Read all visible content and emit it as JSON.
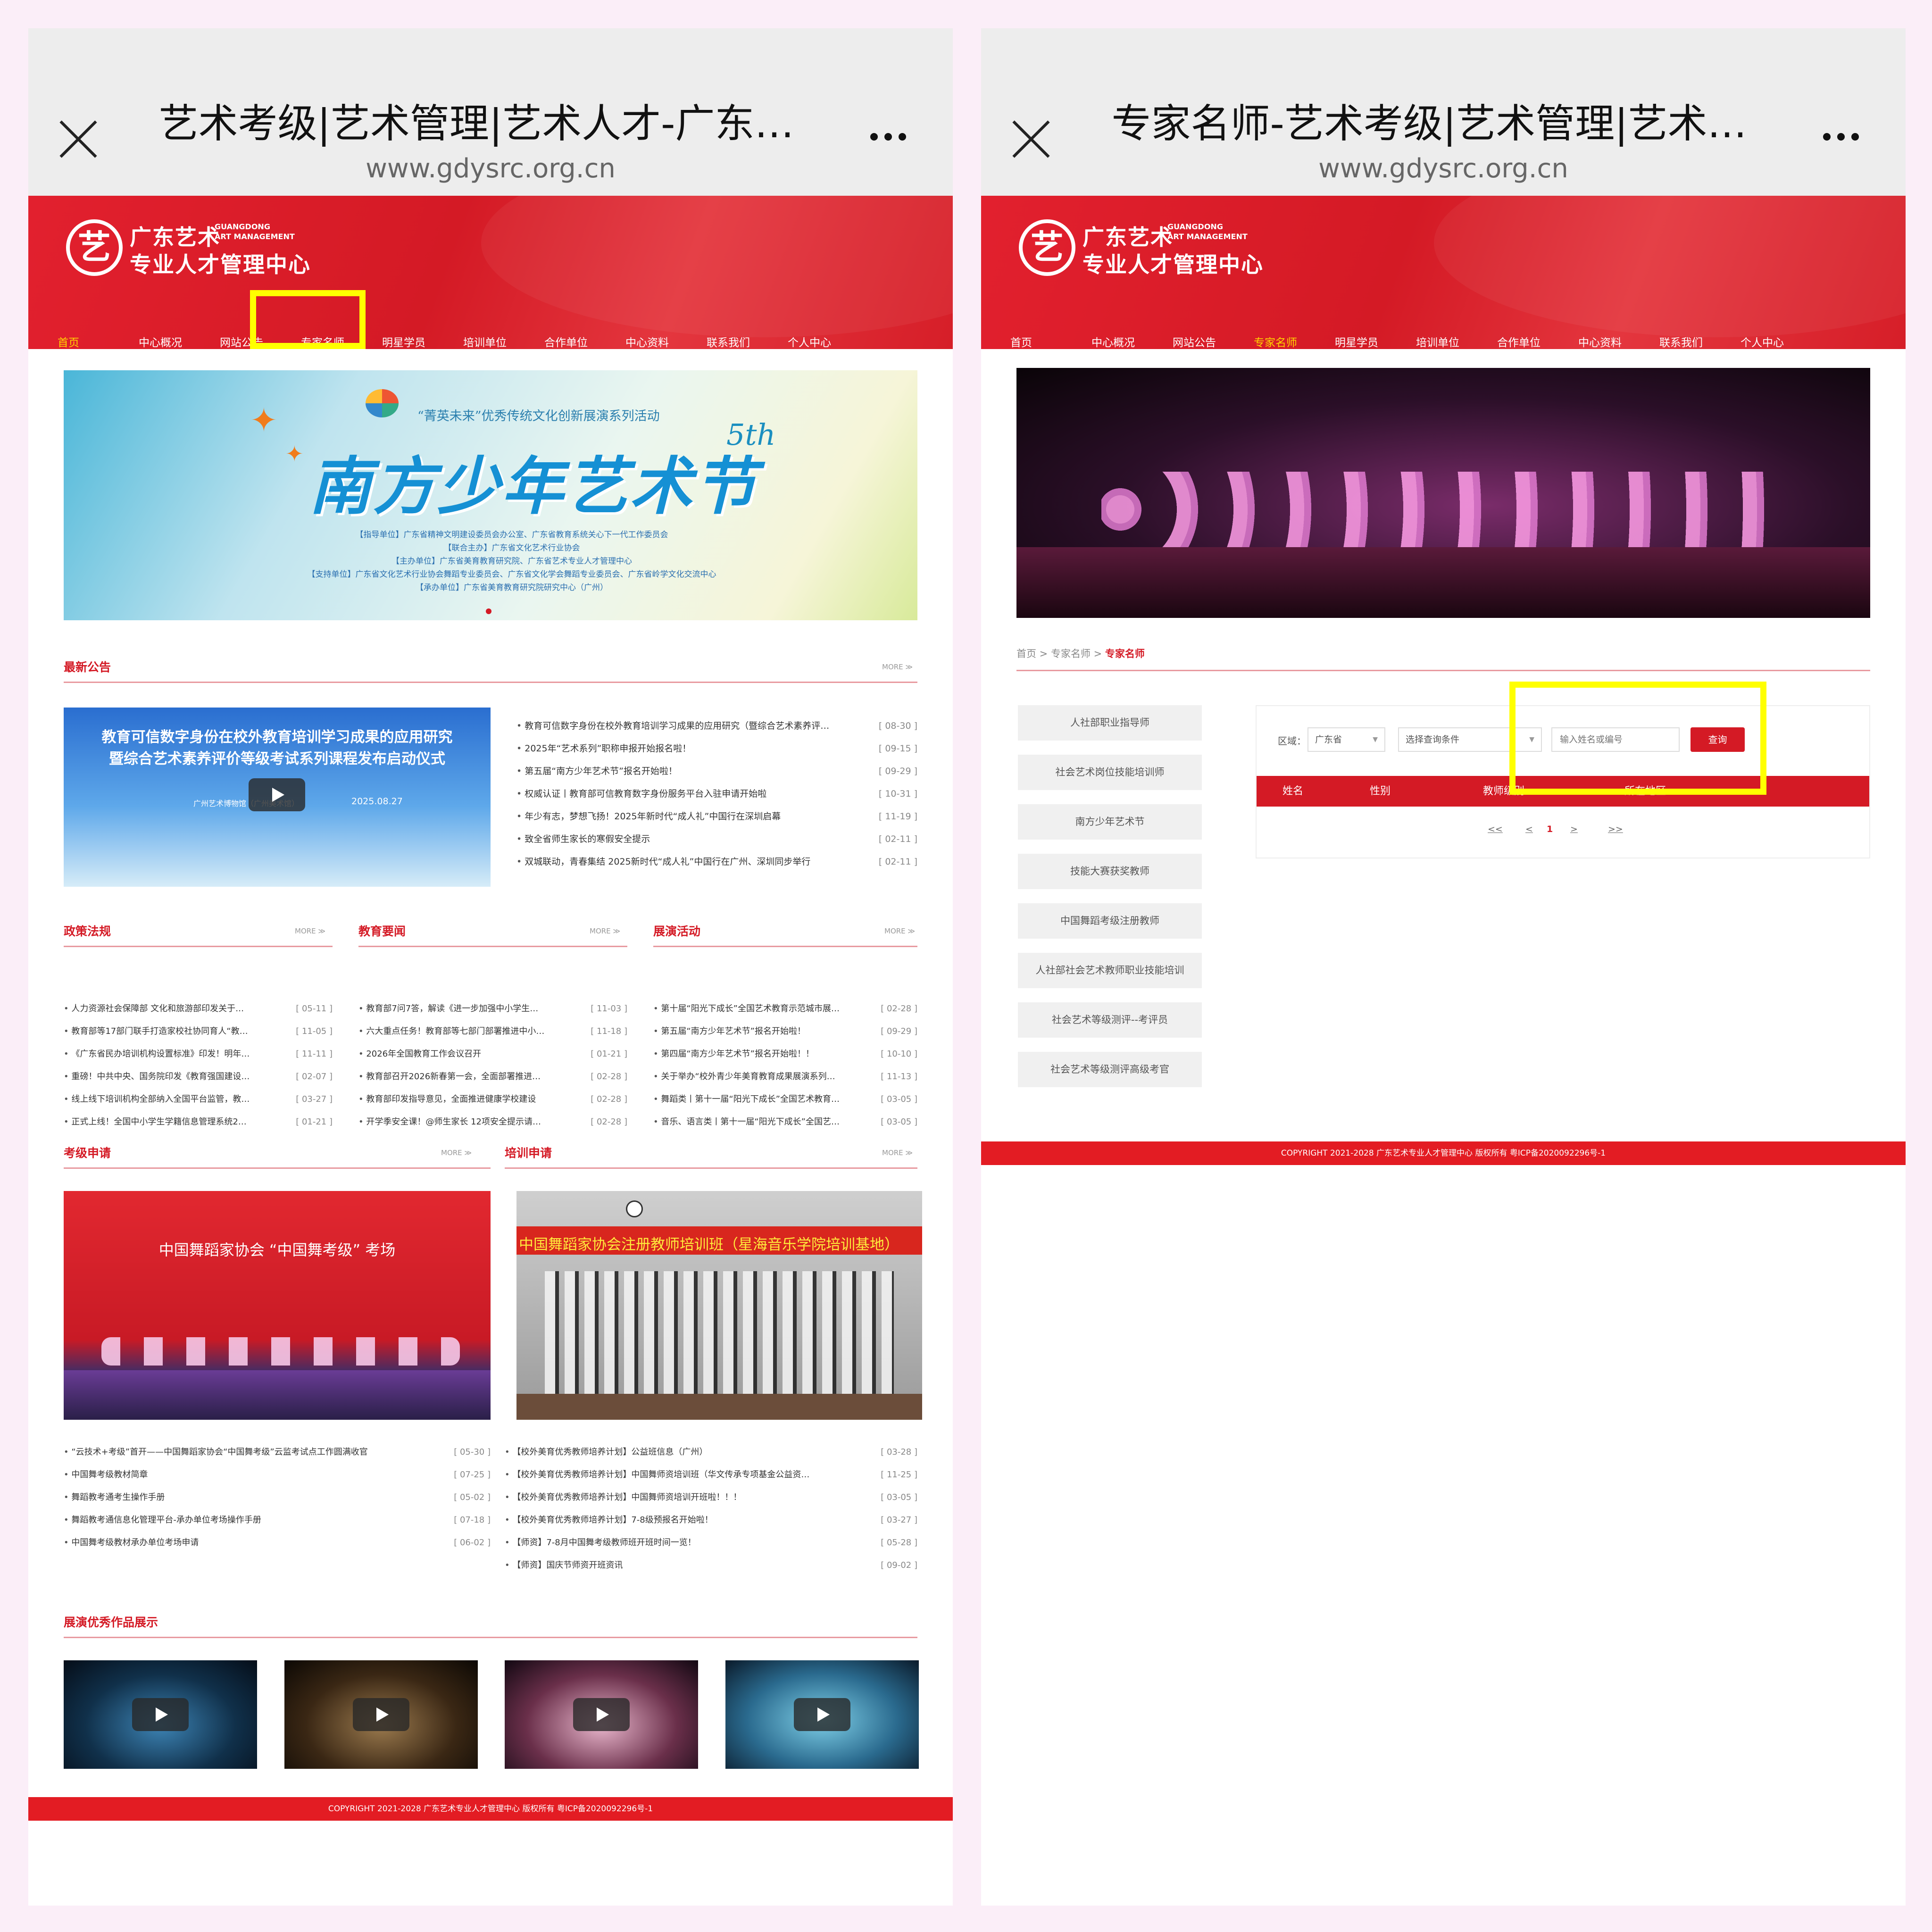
{
  "left": {
    "tab_title": "艺术考级|艺术管理|艺术人才-广东…",
    "url": "www.gdysrc.org.cn",
    "logo": {
      "mark": "艺",
      "cn_line1": "广东艺术",
      "en_line1": "GUANGDONG",
      "en_line2": "ART MANAGEMENT",
      "cn_line2": "专业人才管理中心"
    },
    "nav": [
      "首页",
      "中心概况",
      "网站公告",
      "专家名师",
      "明星学员",
      "培训单位",
      "合作单位",
      "中心资料",
      "联系我们",
      "个人中心"
    ],
    "banner": {
      "subtitle": "“菁英未来”优秀传统文化创新展演系列活动",
      "title": "南方少年艺术节",
      "edition": "5th",
      "credit_lines": [
        "【指导单位】广东省精神文明建设委员会办公室、广东省教育系统关心下一代工作委员会",
        "【联合主办】广东省文化艺术行业协会",
        "【主办单位】广东省美育教育研究院、广东省艺术专业人才管理中心",
        "【支持单位】广东省文化艺术行业协会舞蹈专业委员会、广东省文化学会舞蹈专业委员会、广东省岭学文化交流中心",
        "【承办单位】广东省美育教育研究院研究中心（广州）"
      ]
    },
    "latest": {
      "title": "最新公告",
      "more": "MORE ≫",
      "video_title_line1": "教育可信数字身份在校外教育培训学习成果的应用研究",
      "video_title_line2": "暨综合艺术素养评价等级考试系列课程发布启动仪式",
      "video_venue": "广州艺术博物馆（广州美术馆）",
      "video_date": "2025.08.27",
      "items": [
        {
          "text": "教育可信数字身份在校外教育培训学习成果的应用研究（暨综合艺术素养评…",
          "date": "[ 08-30 ]"
        },
        {
          "text": "2025年“艺术系列”职称申报开始报名啦！",
          "date": "[ 09-15 ]"
        },
        {
          "text": "第五届“南方少年艺术节”报名开始啦！",
          "date": "[ 09-29 ]"
        },
        {
          "text": "权威认证丨教育部可信教育数字身份服务平台入驻申请开始啦",
          "date": "[ 10-31 ]"
        },
        {
          "text": "年少有志，梦想飞扬！2025年新时代“成人礼”中国行在深圳启幕",
          "date": "[ 11-19 ]"
        },
        {
          "text": "致全省师生家长的寒假安全提示",
          "date": "[ 02-11 ]"
        },
        {
          "text": "双城联动，青春集结 2025新时代“成人礼”中国行在广州、深圳同步举行",
          "date": "[ 02-11 ]"
        }
      ]
    },
    "policy": {
      "title": "政策法规",
      "more": "MORE ≫",
      "items": [
        {
          "text": "人力资源社会保障部 文化和旅游部印发关于…",
          "date": "[ 05-11 ]"
        },
        {
          "text": "教育部等17部门联手打造家校社协同育人“教…",
          "date": "[ 11-05 ]"
        },
        {
          "text": "《广东省民办培训机构设置标准》印发！明年…",
          "date": "[ 11-11 ]"
        },
        {
          "text": "重磅！中共中央、国务院印发《教育强国建设…",
          "date": "[ 02-07 ]"
        },
        {
          "text": "线上线下培训机构全部纳入全国平台监管，教…",
          "date": "[ 03-27 ]"
        },
        {
          "text": "正式上线！全国中小学生学籍信息管理系统2…",
          "date": "[ 01-21 ]"
        }
      ]
    },
    "edu": {
      "title": "教育要闻",
      "more": "MORE ≫",
      "items": [
        {
          "text": "教育部7问7答，解读《进一步加强中小学生…",
          "date": "[ 11-03 ]"
        },
        {
          "text": "六大重点任务！教育部等七部门部署推进中小…",
          "date": "[ 11-18 ]"
        },
        {
          "text": "2026年全国教育工作会议召开",
          "date": "[ 01-21 ]"
        },
        {
          "text": "教育部召开2026新春第一会，全面部署推进…",
          "date": "[ 02-28 ]"
        },
        {
          "text": "教育部印发指导意见，全面推进健康学校建设",
          "date": "[ 02-28 ]"
        },
        {
          "text": "开学季安全课！@师生家长 12项安全提示请…",
          "date": "[ 02-28 ]"
        }
      ]
    },
    "show": {
      "title": "展演活动",
      "more": "MORE ≫",
      "items": [
        {
          "text": "第十届“阳光下成长”全国艺术教育示范城市展…",
          "date": "[ 02-28 ]"
        },
        {
          "text": "第五届“南方少年艺术节”报名开始啦！",
          "date": "[ 09-29 ]"
        },
        {
          "text": "第四届“南方少年艺术节”报名开始啦！！",
          "date": "[ 10-10 ]"
        },
        {
          "text": "关于举办“校外青少年美育教育成果展演系列…",
          "date": "[ 11-13 ]"
        },
        {
          "text": "舞蹈类丨第十一届“阳光下成长”全国艺术教育…",
          "date": "[ 03-05 ]"
        },
        {
          "text": "音乐、语言类丨第十一届“阳光下成长”全国艺…",
          "date": "[ 03-05 ]"
        }
      ]
    },
    "exam": {
      "title": "考级申请",
      "more": "MORE ≫",
      "image_caption": "中国舞蹈家协会 “中国舞考级” 考场",
      "items": [
        {
          "text": "“云技术+考级”首开——中国舞蹈家协会“中国舞考级”云监考试点工作圆满收官",
          "date": "[ 05-30 ]"
        },
        {
          "text": "中国舞考级教材简章",
          "date": "[ 07-25 ]"
        },
        {
          "text": "舞蹈教考通考生操作手册",
          "date": "[ 05-02 ]"
        },
        {
          "text": "舞蹈教考通信息化管理平台-承办单位考场操作手册",
          "date": "[ 07-18 ]"
        },
        {
          "text": "中国舞考级教材承办单位考场申请",
          "date": "[ 06-02 ]"
        }
      ]
    },
    "training": {
      "title": "培训申请",
      "more": "MORE ≫",
      "image_caption": "中国舞蹈家协会注册教师培训班（星海音乐学院培训基地）",
      "items": [
        {
          "text": "【校外美育优秀教师培养计划】公益班信息（广州）",
          "date": "[ 03-28 ]"
        },
        {
          "text": "【校外美育优秀教师培养计划】中国舞师资培训班（华文传承专项基金公益资…",
          "date": "[ 11-25 ]"
        },
        {
          "text": "【校外美育优秀教师培养计划】中国舞师资培训开班啦！！！",
          "date": "[ 03-05 ]"
        },
        {
          "text": "【校外美育优秀教师培养计划】7-8级预报名开始啦！",
          "date": "[ 03-27 ]"
        },
        {
          "text": "【师资】7-8月中国舞考级教师班开班时间一览！",
          "date": "[ 05-28 ]"
        },
        {
          "text": "【师资】国庆节师资开班资讯",
          "date": "[ 09-02 ]"
        }
      ]
    },
    "works": {
      "title": "展演优秀作品展示"
    },
    "footer": "COPYRIGHT 2021-2028 广东艺术专业人才管理中心 版权所有 粤ICP备2020092296号-1"
  },
  "right": {
    "tab_title": "专家名师-艺术考级|艺术管理|艺术…",
    "url": "www.gdysrc.org.cn",
    "breadcrumb": {
      "home": "首页",
      "sep": " > ",
      "section": "专家名师",
      "current": "专家名师"
    },
    "side_menu": [
      "人社部职业指导师",
      "社会艺术岗位技能培训师",
      "南方少年艺术节",
      "技能大赛获奖教师",
      "中国舞蹈考级注册教师",
      "人社部社会艺术教师职业技能培训",
      "社会艺术等级测评--考评员",
      "社会艺术等级测评高级考官"
    ],
    "filter": {
      "region_label": "区域：",
      "region_value": "广东省",
      "condition_value": "选择查询条件",
      "search_placeholder": "输入姓名或编号",
      "query_button": "查询"
    },
    "table_headers": [
      "姓名",
      "性别",
      "教师级别",
      "所在地区"
    ],
    "pagination": {
      "first": "<<",
      "prev": "<",
      "current": "1",
      "next": ">",
      "last": ">>"
    },
    "footer": "COPYRIGHT 2021-2028 广东艺术专业人才管理中心 版权所有 粤ICP备2020092296号-1"
  },
  "colors": {
    "brand_red": "#d41a25",
    "highlight": "#ffff00",
    "nav_active": "#ffd200"
  }
}
